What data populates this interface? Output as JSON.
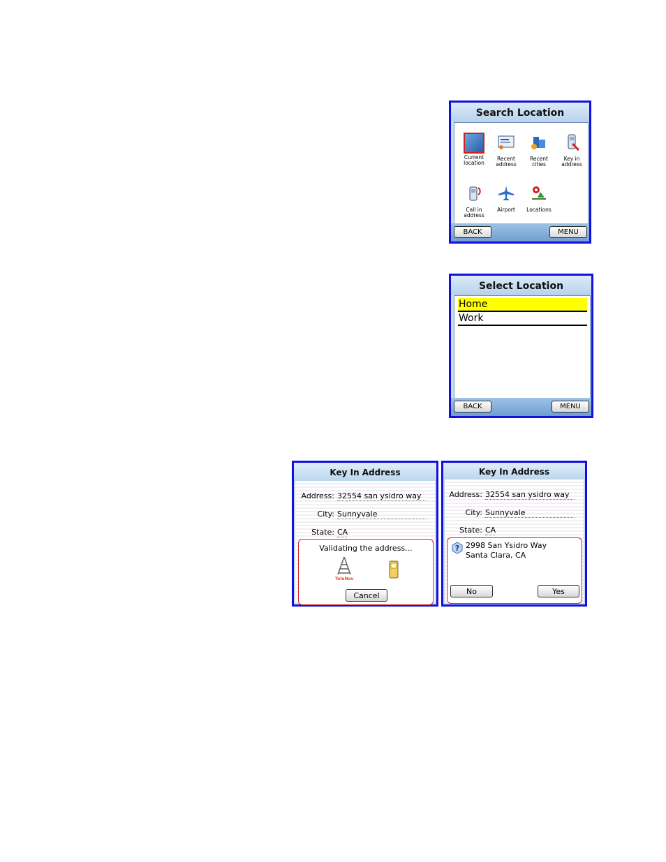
{
  "search_location": {
    "title": "Search Location",
    "items": [
      {
        "label_1": "Current",
        "label_2": "location",
        "icon": "current-location-icon"
      },
      {
        "label_1": "Recent",
        "label_2": "address",
        "icon": "recent-address-icon"
      },
      {
        "label_1": "Recent",
        "label_2": "cities",
        "icon": "recent-cities-icon"
      },
      {
        "label_1": "Key in",
        "label_2": "address",
        "icon": "key-in-address-icon"
      },
      {
        "label_1": "Call in",
        "label_2": "address",
        "icon": "call-in-address-icon"
      },
      {
        "label_1": "Airport",
        "label_2": "",
        "icon": "airport-icon"
      },
      {
        "label_1": "Locations",
        "label_2": "",
        "icon": "locations-icon"
      }
    ],
    "back_label": "BACK",
    "menu_label": "MENU"
  },
  "select_location": {
    "title": "Select Location",
    "items": [
      "Home",
      "Work"
    ],
    "back_label": "BACK",
    "menu_label": "MENU",
    "highlight_color": "#ffff00"
  },
  "key_in_validating": {
    "title": "Key In Address",
    "address_label": "Address:",
    "address_value": "32554 san ysidro way",
    "city_label": "City:",
    "city_value": "Sunnyvale",
    "state_label": "State:",
    "state_value": "CA",
    "message": "Validating the address...",
    "brand": "TeleNav",
    "cancel_label": "Cancel"
  },
  "key_in_confirm": {
    "title": "Key In Address",
    "address_label": "Address:",
    "address_value": "32554 san ysidro way",
    "city_label": "City:",
    "city_value": "Sunnyvale",
    "state_label": "State:",
    "state_value": "CA",
    "suggest_line1": "2998 San Ysidro Way",
    "suggest_line2": "Santa Clara, CA",
    "no_label": "No",
    "yes_label": "Yes"
  },
  "colors": {
    "frame_border": "#1010e0",
    "dialog_border": "#d02020"
  }
}
